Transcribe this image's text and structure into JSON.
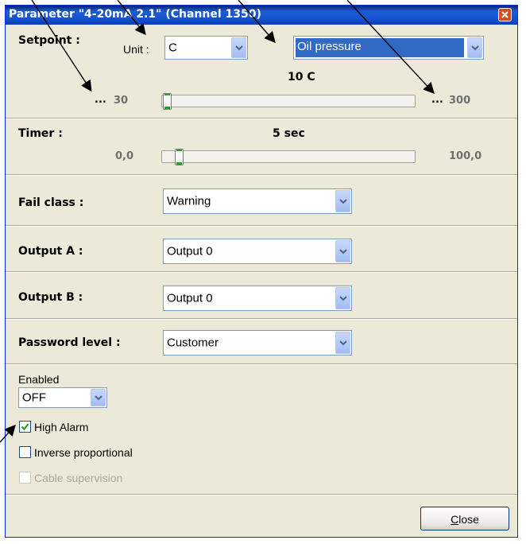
{
  "window": {
    "title": "Parameter \"4-20mA 2.1\" (Channel 1350)"
  },
  "setpoint": {
    "label": "Setpoint :",
    "unit_label": "Unit :",
    "unit_value": "C",
    "signal_value": "Oil pressure",
    "current_value": "10 C",
    "min_prefix": "...",
    "min": "30",
    "max_prefix": "...",
    "max": "300",
    "slider_fraction": 0.0
  },
  "timer": {
    "label": "Timer :",
    "current_value": "5 sec",
    "min": "0,0",
    "max": "100,0",
    "slider_fraction": 0.05
  },
  "fail_class": {
    "label": "Fail class :",
    "value": "Warning"
  },
  "output_a": {
    "label": "Output A :",
    "value": "Output 0"
  },
  "output_b": {
    "label": "Output B :",
    "value": "Output 0"
  },
  "password_level": {
    "label": "Password level :",
    "value": "Customer"
  },
  "enabled": {
    "label": "Enabled",
    "value": "OFF"
  },
  "checkboxes": {
    "high_alarm": {
      "label": "High Alarm",
      "checked": true
    },
    "inverse_proportional": {
      "label": "Inverse proportional",
      "checked": false
    },
    "cable_supervision": {
      "label": "Cable supervision",
      "checked": false,
      "disabled": true
    }
  },
  "buttons": {
    "close": "Close"
  },
  "colors": {
    "titlebar": "#1552d0",
    "face": "#ece9d8",
    "selection": "#316ac5",
    "check_green": "#21a121"
  },
  "icons": {
    "close": "close-icon",
    "dropdown": "chevron-down-icon",
    "check": "check-icon"
  }
}
